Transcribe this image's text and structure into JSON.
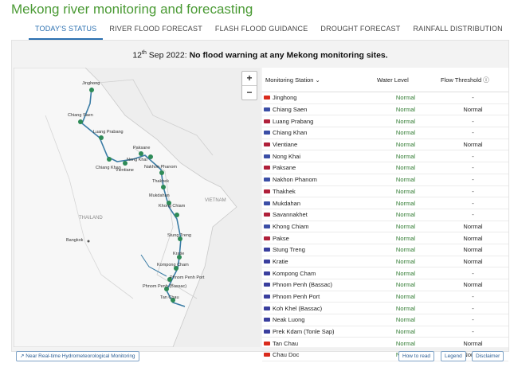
{
  "title": "Mekong river monitoring and forecasting",
  "tabs": [
    "TODAY'S STATUS",
    "RIVER FLOOD FORECAST",
    "FLASH FLOOD GUIDANCE",
    "DROUGHT FORECAST",
    "RAINFALL DISTRIBUTION"
  ],
  "banner": {
    "day": "12",
    "suffix": "th",
    "rest": " Sep 2022:",
    "bold": " No flood warning at any Mekong monitoring sites."
  },
  "map": {
    "zoom_in": "+",
    "zoom_out": "−",
    "labels": [
      "Jinghong",
      "Chiang Saen",
      "Luang Prabang",
      "Chiang Khan",
      "Vientiane",
      "Paksane",
      "Nong Khai",
      "Nakhon Phanom",
      "Thakhek",
      "Mukdahan",
      "Khong Chiam",
      "Stung Treng",
      "Kratie",
      "Kompong Cham",
      "Phnom Penh Port",
      "Phnom Penh (Bassac)",
      "Tan Chau",
      "THAILAND",
      "VIETNAM",
      "Bangkok"
    ]
  },
  "table": {
    "headers": {
      "station": "Monitoring Station",
      "level": "Water Level",
      "flow": "Flow Threshold"
    },
    "rows": [
      {
        "flag": "#d92b1c",
        "station": "Jinghong",
        "level": "Normal",
        "flow": "-"
      },
      {
        "flag": "#3b4ea6",
        "station": "Chiang Saen",
        "level": "Normal",
        "flow": "Normal"
      },
      {
        "flag": "#b0203a",
        "station": "Luang Prabang",
        "level": "Normal",
        "flow": "-"
      },
      {
        "flag": "#3b4ea6",
        "station": "Chiang Khan",
        "level": "Normal",
        "flow": "-"
      },
      {
        "flag": "#b0203a",
        "station": "Vientiane",
        "level": "Normal",
        "flow": "Normal"
      },
      {
        "flag": "#3b4ea6",
        "station": "Nong Khai",
        "level": "Normal",
        "flow": "-"
      },
      {
        "flag": "#b0203a",
        "station": "Paksane",
        "level": "Normal",
        "flow": "-"
      },
      {
        "flag": "#3b4ea6",
        "station": "Nakhon Phanom",
        "level": "Normal",
        "flow": "-"
      },
      {
        "flag": "#b0203a",
        "station": "Thakhek",
        "level": "Normal",
        "flow": "-"
      },
      {
        "flag": "#3b4ea6",
        "station": "Mukdahan",
        "level": "Normal",
        "flow": "-"
      },
      {
        "flag": "#b0203a",
        "station": "Savannakhet",
        "level": "Normal",
        "flow": "-"
      },
      {
        "flag": "#3b4ea6",
        "station": "Khong Chiam",
        "level": "Normal",
        "flow": "Normal"
      },
      {
        "flag": "#b0203a",
        "station": "Pakse",
        "level": "Normal",
        "flow": "Normal"
      },
      {
        "flag": "#3a3f9e",
        "station": "Stung Treng",
        "level": "Normal",
        "flow": "Normal"
      },
      {
        "flag": "#3a3f9e",
        "station": "Kratie",
        "level": "Normal",
        "flow": "Normal"
      },
      {
        "flag": "#3a3f9e",
        "station": "Kompong Cham",
        "level": "Normal",
        "flow": "-"
      },
      {
        "flag": "#3a3f9e",
        "station": "Phnom Penh (Bassac)",
        "level": "Normal",
        "flow": "Normal"
      },
      {
        "flag": "#3a3f9e",
        "station": "Phnom Penh Port",
        "level": "Normal",
        "flow": "-"
      },
      {
        "flag": "#3a3f9e",
        "station": "Koh Khel (Bassac)",
        "level": "Normal",
        "flow": "-"
      },
      {
        "flag": "#3a3f9e",
        "station": "Neak Luong",
        "level": "Normal",
        "flow": "-"
      },
      {
        "flag": "#3a3f9e",
        "station": "Prek Kdam (Tonle Sap)",
        "level": "Normal",
        "flow": "-"
      },
      {
        "flag": "#d92b1c",
        "station": "Tan Chau",
        "level": "Normal",
        "flow": "Normal"
      },
      {
        "flag": "#d92b1c",
        "station": "Chau Doc",
        "level": "Normal",
        "flow": "Normal"
      }
    ]
  },
  "footer": {
    "link": "Near Real-time Hydrometeorological Monitoring",
    "how": "How to read",
    "legend": "Legend",
    "disclaimer": "Disclaimer"
  },
  "colors": {
    "title": "#4a9a34",
    "accent": "#2a6fb0",
    "normal": "#2f7a30",
    "river": "#3a7ca5",
    "pin": "#2e8b57"
  }
}
